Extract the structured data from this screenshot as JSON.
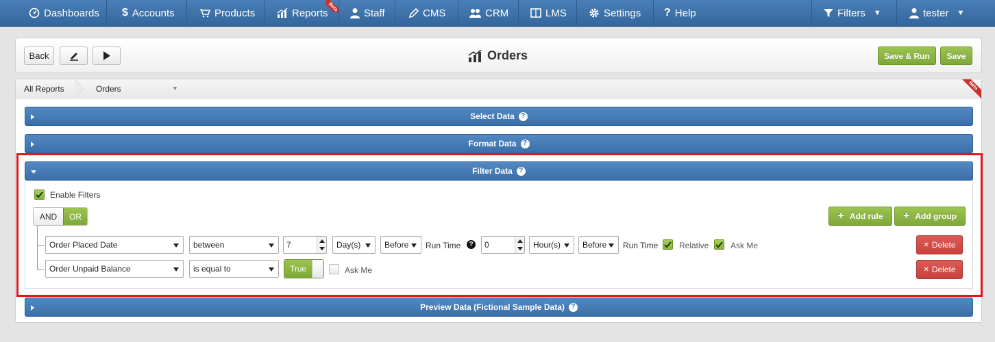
{
  "nav": {
    "items": [
      {
        "label": "Dashboards",
        "icon": "dashboard-icon"
      },
      {
        "label": "Accounts",
        "icon": "dollar-icon"
      },
      {
        "label": "Products",
        "icon": "cart-icon"
      },
      {
        "label": "Reports",
        "icon": "chart-icon",
        "badge": "Beta"
      },
      {
        "label": "Staff",
        "icon": "user-icon"
      },
      {
        "label": "CMS",
        "icon": "pencil-icon"
      },
      {
        "label": "CRM",
        "icon": "users-icon"
      },
      {
        "label": "LMS",
        "icon": "book-icon"
      },
      {
        "label": "Settings",
        "icon": "gear-icon"
      },
      {
        "label": "Help",
        "icon": "question-icon"
      }
    ],
    "filters_label": "Filters",
    "user_label": "tester"
  },
  "header": {
    "back_label": "Back",
    "title": "Orders",
    "save_run_label": "Save & Run",
    "save_label": "Save"
  },
  "breadcrumb": {
    "root": "All Reports",
    "current": "Orders",
    "badge": "Beta"
  },
  "sections": {
    "select_data": "Select Data",
    "format_data": "Format Data",
    "filter_data": "Filter Data",
    "preview_data": "Preview Data (Fictional Sample Data)"
  },
  "filters": {
    "enable_label": "Enable Filters",
    "and_label": "AND",
    "or_label": "OR",
    "add_rule_label": "Add rule",
    "add_group_label": "Add group",
    "rule1": {
      "field": "Order Placed Date",
      "operator": "between",
      "value1": "7",
      "unit1": "Day(s)",
      "relation1": "Before",
      "runtime1": "Run Time",
      "value2": "0",
      "unit2": "Hour(s)",
      "relation2": "Before",
      "runtime2": "Run Time",
      "relative_label": "Relative",
      "ask_me_label": "Ask Me",
      "delete_label": "Delete"
    },
    "rule2": {
      "field": "Order Unpaid Balance",
      "operator": "is equal to",
      "toggle_value": "True",
      "ask_me_label": "Ask Me",
      "delete_label": "Delete"
    }
  },
  "colors": {
    "nav_blue": "#3a6fa9",
    "accent_green": "#86b43e",
    "delete_red": "#c9413c",
    "highlight_red": "#e0161b"
  }
}
